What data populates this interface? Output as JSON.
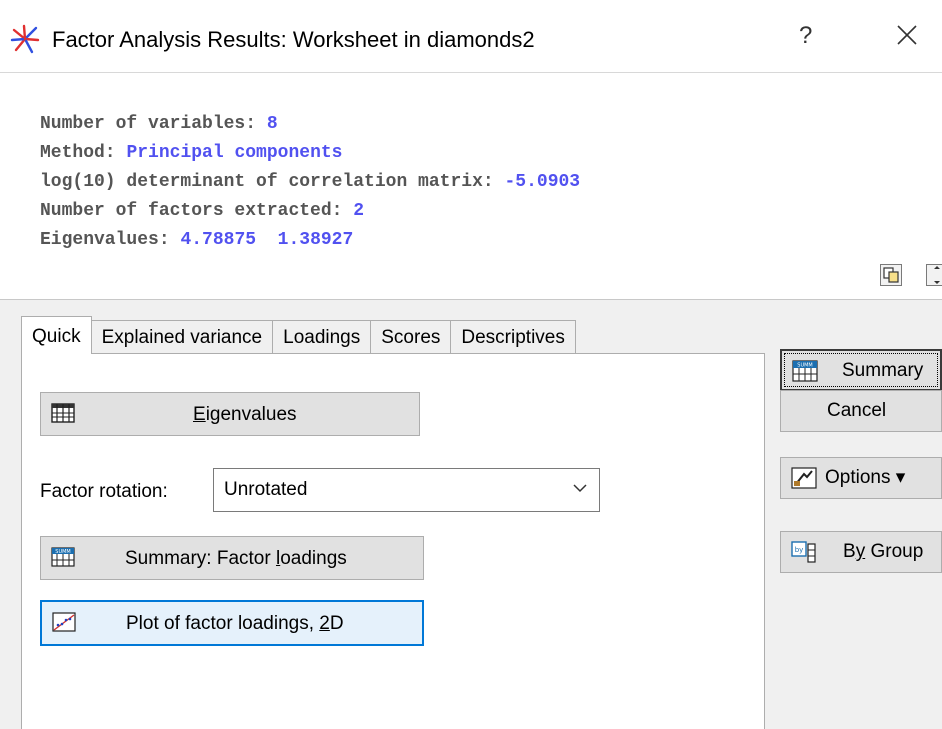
{
  "window": {
    "title": "Factor Analysis Results: Worksheet in diamonds2",
    "help_glyph": "?",
    "icons": {
      "app": "statistica-app-icon",
      "close": "close-icon"
    }
  },
  "summary": {
    "num_variables_label": "Number of variables:",
    "num_variables_value": "8",
    "method_label": "Method:",
    "method_value": "Principal components",
    "determinant_label": "log(10) determinant of correlation matrix:",
    "determinant_value": "-5.0903",
    "factors_label": "Number of factors extracted:",
    "factors_value": "2",
    "eigen_label": "Eigenvalues:",
    "eigen_value_1": "4.78875",
    "eigen_value_2": "1.38927"
  },
  "tabs": [
    {
      "label": "Quick",
      "active": true
    },
    {
      "label": "Explained variance",
      "active": false
    },
    {
      "label": "Loadings",
      "active": false
    },
    {
      "label": "Scores",
      "active": false
    },
    {
      "label": "Descriptives",
      "active": false
    }
  ],
  "quick": {
    "eigenvalues_button": {
      "hotkey": "E",
      "rest": "igenvalues"
    },
    "rotation_label": "Factor rotation:",
    "rotation_value": "Unrotated",
    "summary_loadings_button": {
      "pre": "Summary: Factor ",
      "hotkey": "l",
      "rest": "oadings"
    },
    "plot_loadings_button": {
      "pre": "Plot of factor loadings, ",
      "hotkey": "2",
      "rest": "D"
    }
  },
  "right_buttons": {
    "summary": "Summary",
    "cancel": "Cancel",
    "options": "Options",
    "by_group_pre": "B",
    "by_group_hotkey": "y",
    "by_group_rest": " Group"
  },
  "colors": {
    "value_text": "#5151f0",
    "label_text": "#555555",
    "panel_bg": "#f0f0f0",
    "focus_border": "#0078d7"
  }
}
